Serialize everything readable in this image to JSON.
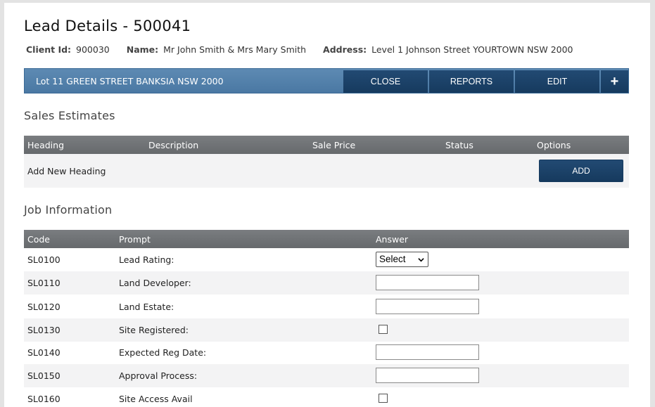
{
  "page": {
    "title": "Lead Details - 500041"
  },
  "client": {
    "client_id_label": "Client Id:",
    "client_id": "900030",
    "name_label": "Name:",
    "name": "Mr John Smith & Mrs Mary Smith",
    "address_label": "Address:",
    "address": "Level 1 Johnson Street YOURTOWN NSW 2000"
  },
  "lot_bar": {
    "label": "Lot 11 GREEN STREET BANKSIA NSW 2000",
    "close_label": "CLOSE",
    "reports_label": "REPORTS",
    "edit_label": "EDIT",
    "add_label": "+"
  },
  "sales_estimates": {
    "title": "Sales Estimates",
    "columns": {
      "heading": "Heading",
      "description": "Description",
      "sale_price": "Sale Price",
      "status": "Status",
      "options": "Options"
    },
    "add_row_label": "Add New Heading",
    "add_button_label": "ADD"
  },
  "job_information": {
    "title": "Job Information",
    "columns": {
      "code": "Code",
      "prompt": "Prompt",
      "answer": "Answer"
    },
    "rows": [
      {
        "code": "SL0100",
        "prompt": "Lead Rating:",
        "answer_type": "select",
        "answer_value": "Select"
      },
      {
        "code": "SL0110",
        "prompt": "Land Developer:",
        "answer_type": "text",
        "answer_value": ""
      },
      {
        "code": "SL0120",
        "prompt": "Land Estate:",
        "answer_type": "text",
        "answer_value": ""
      },
      {
        "code": "SL0130",
        "prompt": "Site Registered:",
        "answer_type": "checkbox",
        "answer_value": ""
      },
      {
        "code": "SL0140",
        "prompt": "Expected Reg Date:",
        "answer_type": "text",
        "answer_value": ""
      },
      {
        "code": "SL0150",
        "prompt": "Approval Process:",
        "answer_type": "text",
        "answer_value": ""
      },
      {
        "code": "SL0160",
        "prompt": "Site Access Avail",
        "answer_type": "checkbox",
        "answer_value": ""
      }
    ]
  },
  "colors": {
    "lot_bar": "#5d8ab3",
    "button_dark": "#1b4268",
    "grid_header": "#6f7275",
    "alt_row": "#f3f3f4"
  }
}
